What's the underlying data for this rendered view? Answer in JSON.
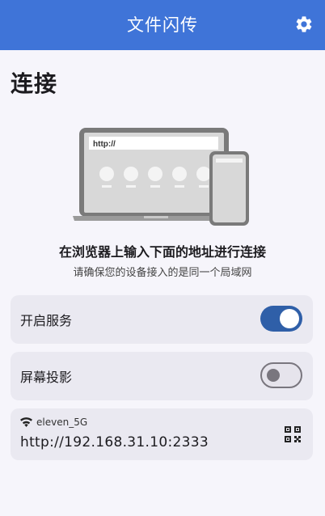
{
  "app": {
    "title": "文件闪传"
  },
  "page": {
    "title": "连接"
  },
  "illustration": {
    "url_text": "http://"
  },
  "instructions": {
    "headline": "在浏览器上输入下面的地址进行连接",
    "subline": "请确保您的设备接入的是同一个局域网"
  },
  "settings": {
    "service": {
      "label": "开启服务",
      "enabled": true
    },
    "screen_projection": {
      "label": "屏幕投影",
      "enabled": false
    }
  },
  "connection": {
    "wifi_name": "eleven_5G",
    "address": "http://192.168.31.10:2333"
  },
  "colors": {
    "primary": "#3f74d8",
    "toggle_on": "#2f5fa8"
  },
  "icons": {
    "settings": "gear-icon",
    "wifi": "wifi-icon",
    "qr": "qr-code-icon"
  }
}
